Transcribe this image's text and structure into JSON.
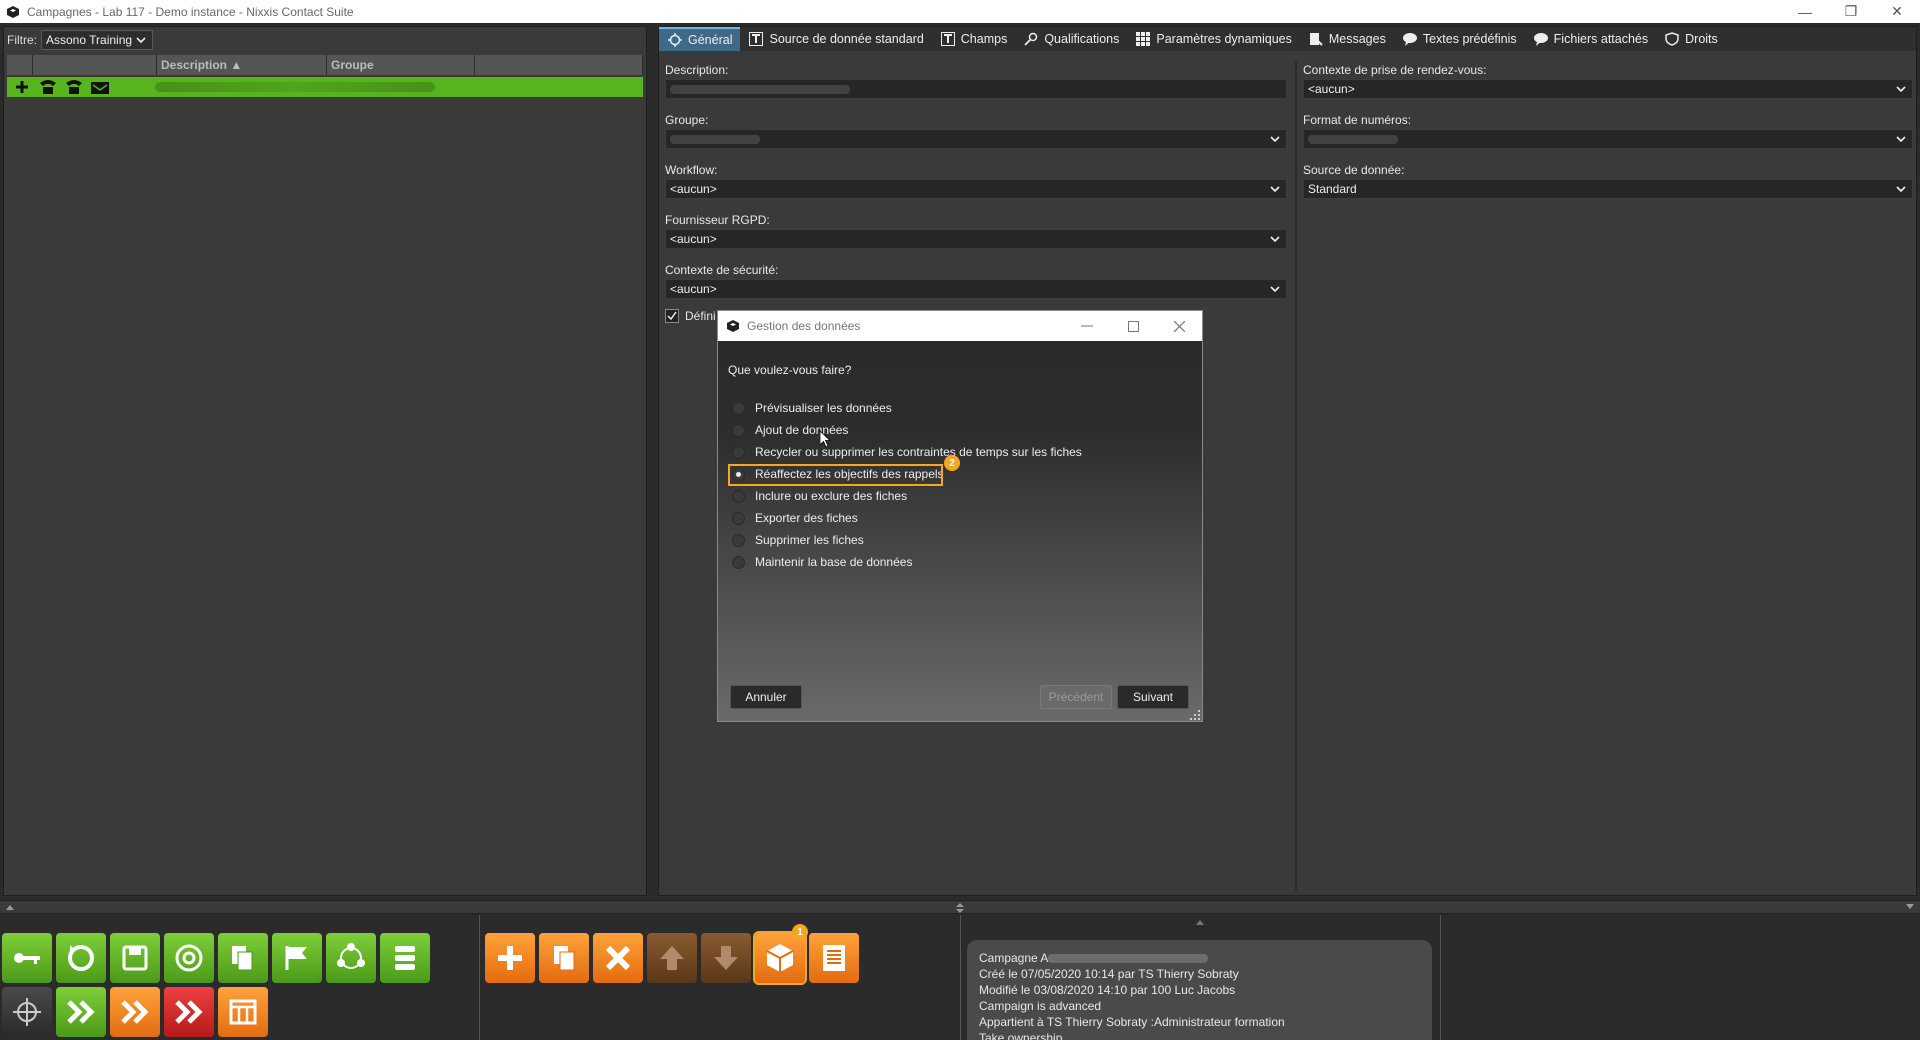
{
  "window": {
    "title": "Campagnes - Lab 117 - Demo instance - Nixxis Contact Suite",
    "minimize": "—",
    "restore": "❐",
    "close": "✕"
  },
  "left": {
    "filter_label": "Filtre:",
    "filter_value": "Assono Training",
    "columns": [
      "",
      "",
      "Description ▲",
      "Groupe",
      ""
    ]
  },
  "tabs": [
    {
      "label": "Général",
      "icon": "gear-icon"
    },
    {
      "label": "Source de donnée standard",
      "icon": "t-icon"
    },
    {
      "label": "Champs",
      "icon": "t-icon"
    },
    {
      "label": "Qualifications",
      "icon": "key-icon"
    },
    {
      "label": "Paramètres dynamiques",
      "icon": "grid-icon"
    },
    {
      "label": "Messages",
      "icon": "message-icon"
    },
    {
      "label": "Textes prédéfinis",
      "icon": "speech-icon"
    },
    {
      "label": "Fichiers attachés",
      "icon": "speech-icon"
    },
    {
      "label": "Droits",
      "icon": "shield-icon"
    }
  ],
  "form": {
    "description_label": "Description:",
    "groupe_label": "Groupe:",
    "workflow_label": "Workflow:",
    "workflow_value": "<aucun>",
    "rgpd_label": "Fournisseur RGPD:",
    "rgpd_value": "<aucun>",
    "securite_label": "Contexte de sécurité:",
    "securite_value": "<aucun>",
    "checkbox_label": "Défini",
    "rdv_label": "Contexte de prise de rendez-vous:",
    "rdv_value": "<aucun>",
    "numeros_label": "Format de numéros:",
    "source_label": "Source de donnée:",
    "source_value": "Standard"
  },
  "dialog": {
    "title": "Gestion des données",
    "question": "Que voulez-vous faire?",
    "options": [
      "Prévisualiser les données",
      "Ajout de données",
      "Recycler ou supprimer les contraintes de temps sur les fiches",
      "Réaffectez les objectifs des rappels",
      "Inclure ou exclure des fiches",
      "Exporter des fiches",
      "Supprimer les fiches",
      "Maintenir la base de données"
    ],
    "selected_index": 3,
    "step_badge": "2",
    "cancel": "Annuler",
    "previous": "Précédent",
    "next": "Suivant"
  },
  "toolbar": {
    "step_badge": "1"
  },
  "info": {
    "line1_prefix": "Campagne A",
    "line2": "Créé le 07/05/2020 10:14 par TS Thierry Sobraty",
    "line3": "Modifié le 03/08/2020 14:10 par 100 Luc Jacobs",
    "line4": "Campaign is advanced",
    "line5": "Appartient à TS Thierry Sobraty :Administrateur formation",
    "line6": "Take ownership"
  },
  "colors": {
    "accent_green": "#57b41d",
    "accent_orange": "#f5a623",
    "active_tab": "#3d6a8a"
  }
}
